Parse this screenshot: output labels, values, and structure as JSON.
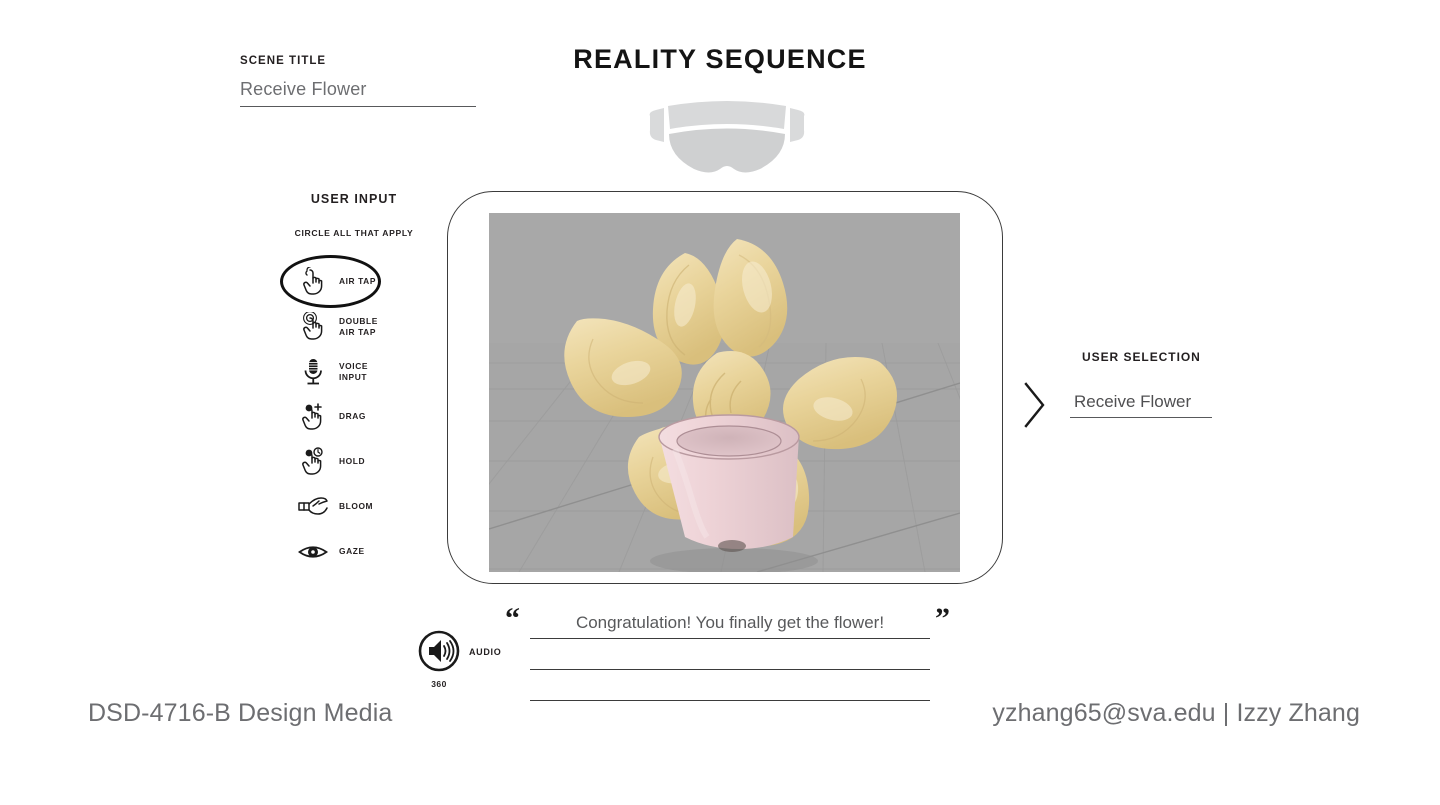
{
  "header": {
    "title": "REALITY SEQUENCE",
    "headset_icon": "vr-headset-icon"
  },
  "scene_title": {
    "label": "SCENE TITLE",
    "value": "Receive Flower"
  },
  "user_input": {
    "heading": "USER INPUT",
    "instruction": "CIRCLE ALL THAT APPLY",
    "selected": "AIR TAP",
    "options": [
      {
        "label": "AIR TAP",
        "icon": "air-tap-icon",
        "selected": true
      },
      {
        "label": "DOUBLE\nAIR TAP",
        "icon": "double-air-tap-icon",
        "selected": false
      },
      {
        "label": "VOICE\nINPUT",
        "icon": "microphone-icon",
        "selected": false
      },
      {
        "label": "DRAG",
        "icon": "drag-icon",
        "selected": false
      },
      {
        "label": "HOLD",
        "icon": "hold-icon",
        "selected": false
      },
      {
        "label": "BLOOM",
        "icon": "bloom-hand-icon",
        "selected": false
      },
      {
        "label": "GAZE",
        "icon": "eye-gaze-icon",
        "selected": false
      }
    ]
  },
  "user_selection": {
    "heading": "USER SELECTION",
    "value": "Receive Flower",
    "arrow_icon": "chevron-right-icon"
  },
  "scene": {
    "description": "3D rendered yellow flower in a pink pot on a gray perspective grid",
    "background_color": "#a6a6a6",
    "flower_color": "#e8d49a",
    "pot_color": "#ecd2d6",
    "stem_color": "#2f9e2f"
  },
  "audio": {
    "label": "AUDIO",
    "spatial": "360",
    "icon": "speaker-volume-icon"
  },
  "caption": {
    "quote_open": "“",
    "quote_close": "”",
    "lines": [
      "Congratulation! You finally get the flower!",
      "",
      ""
    ]
  },
  "footer": {
    "left": "DSD-4716-B Design Media",
    "right": "yzhang65@sva.edu | Izzy Zhang"
  }
}
